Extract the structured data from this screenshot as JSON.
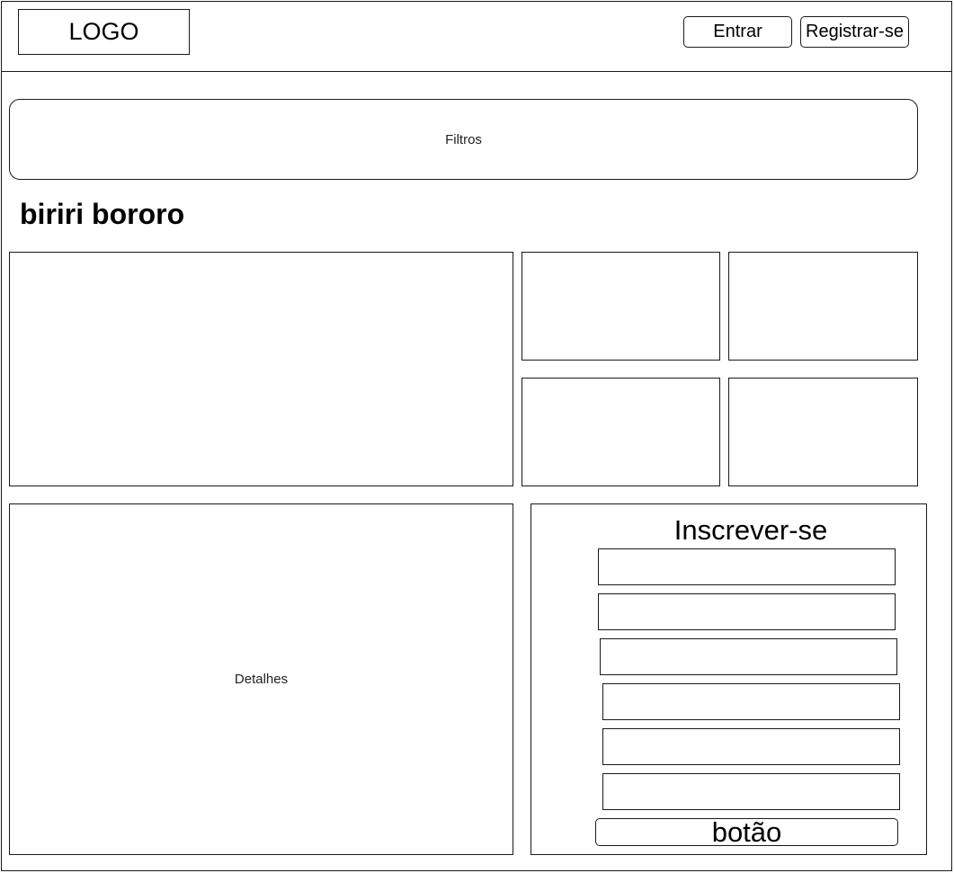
{
  "header": {
    "logo_label": "LOGO",
    "login_label": "Entrar",
    "register_label": "Registrar-se"
  },
  "filters": {
    "label": "Filtros"
  },
  "event": {
    "title": "biriri bororo"
  },
  "details": {
    "label": "Detalhes"
  },
  "signup": {
    "title": "Inscrever-se",
    "fields": [
      "",
      "",
      "",
      "",
      "",
      ""
    ],
    "submit_label": "botão"
  }
}
